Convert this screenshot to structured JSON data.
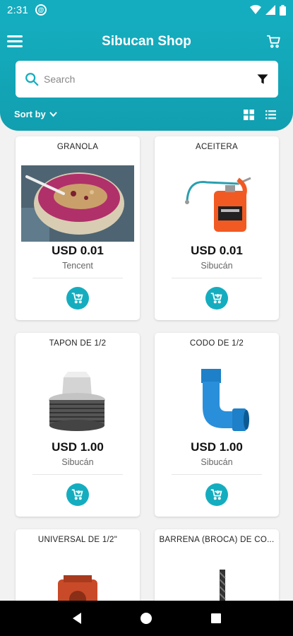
{
  "status_bar": {
    "time": "2:31",
    "app_icon": "at-sign-icon",
    "icons": [
      "wifi-icon",
      "signal-icon",
      "battery-icon"
    ]
  },
  "header": {
    "title": "Sibucan Shop",
    "menu_icon": "hamburger-menu-icon",
    "cart_icon": "cart-icon"
  },
  "search": {
    "placeholder": "Search",
    "value": "",
    "filter_icon": "filter-icon"
  },
  "sort": {
    "label": "Sort by",
    "views": [
      "grid-view-icon",
      "list-view-icon"
    ],
    "active_view": "grid"
  },
  "products": [
    {
      "name": "GRANOLA",
      "price": "USD 0.01",
      "store": "Tencent",
      "image": "granola-bowl"
    },
    {
      "name": "ACEITERA",
      "price": "USD 0.01",
      "store": "Sibucán",
      "image": "oil-can"
    },
    {
      "name": "TAPÓN DE 1/2",
      "price": "USD 1.00",
      "store": "Sibucán",
      "image": "pipe-plug"
    },
    {
      "name": "CODO DE 1/2",
      "price": "USD 1.00",
      "store": "Sibucán",
      "image": "pipe-elbow"
    },
    {
      "name": "UNIVERSAL DE 1/2\"",
      "price": "",
      "store": "",
      "image": "pipe-union"
    },
    {
      "name": "BARRENA (BROCA) DE CO...",
      "price": "",
      "store": "",
      "image": "drill-bit"
    }
  ],
  "colors": {
    "primary": "#14adbf",
    "background": "#f2f2f2"
  },
  "nav_bar": [
    "back-icon",
    "home-icon",
    "recents-icon"
  ]
}
